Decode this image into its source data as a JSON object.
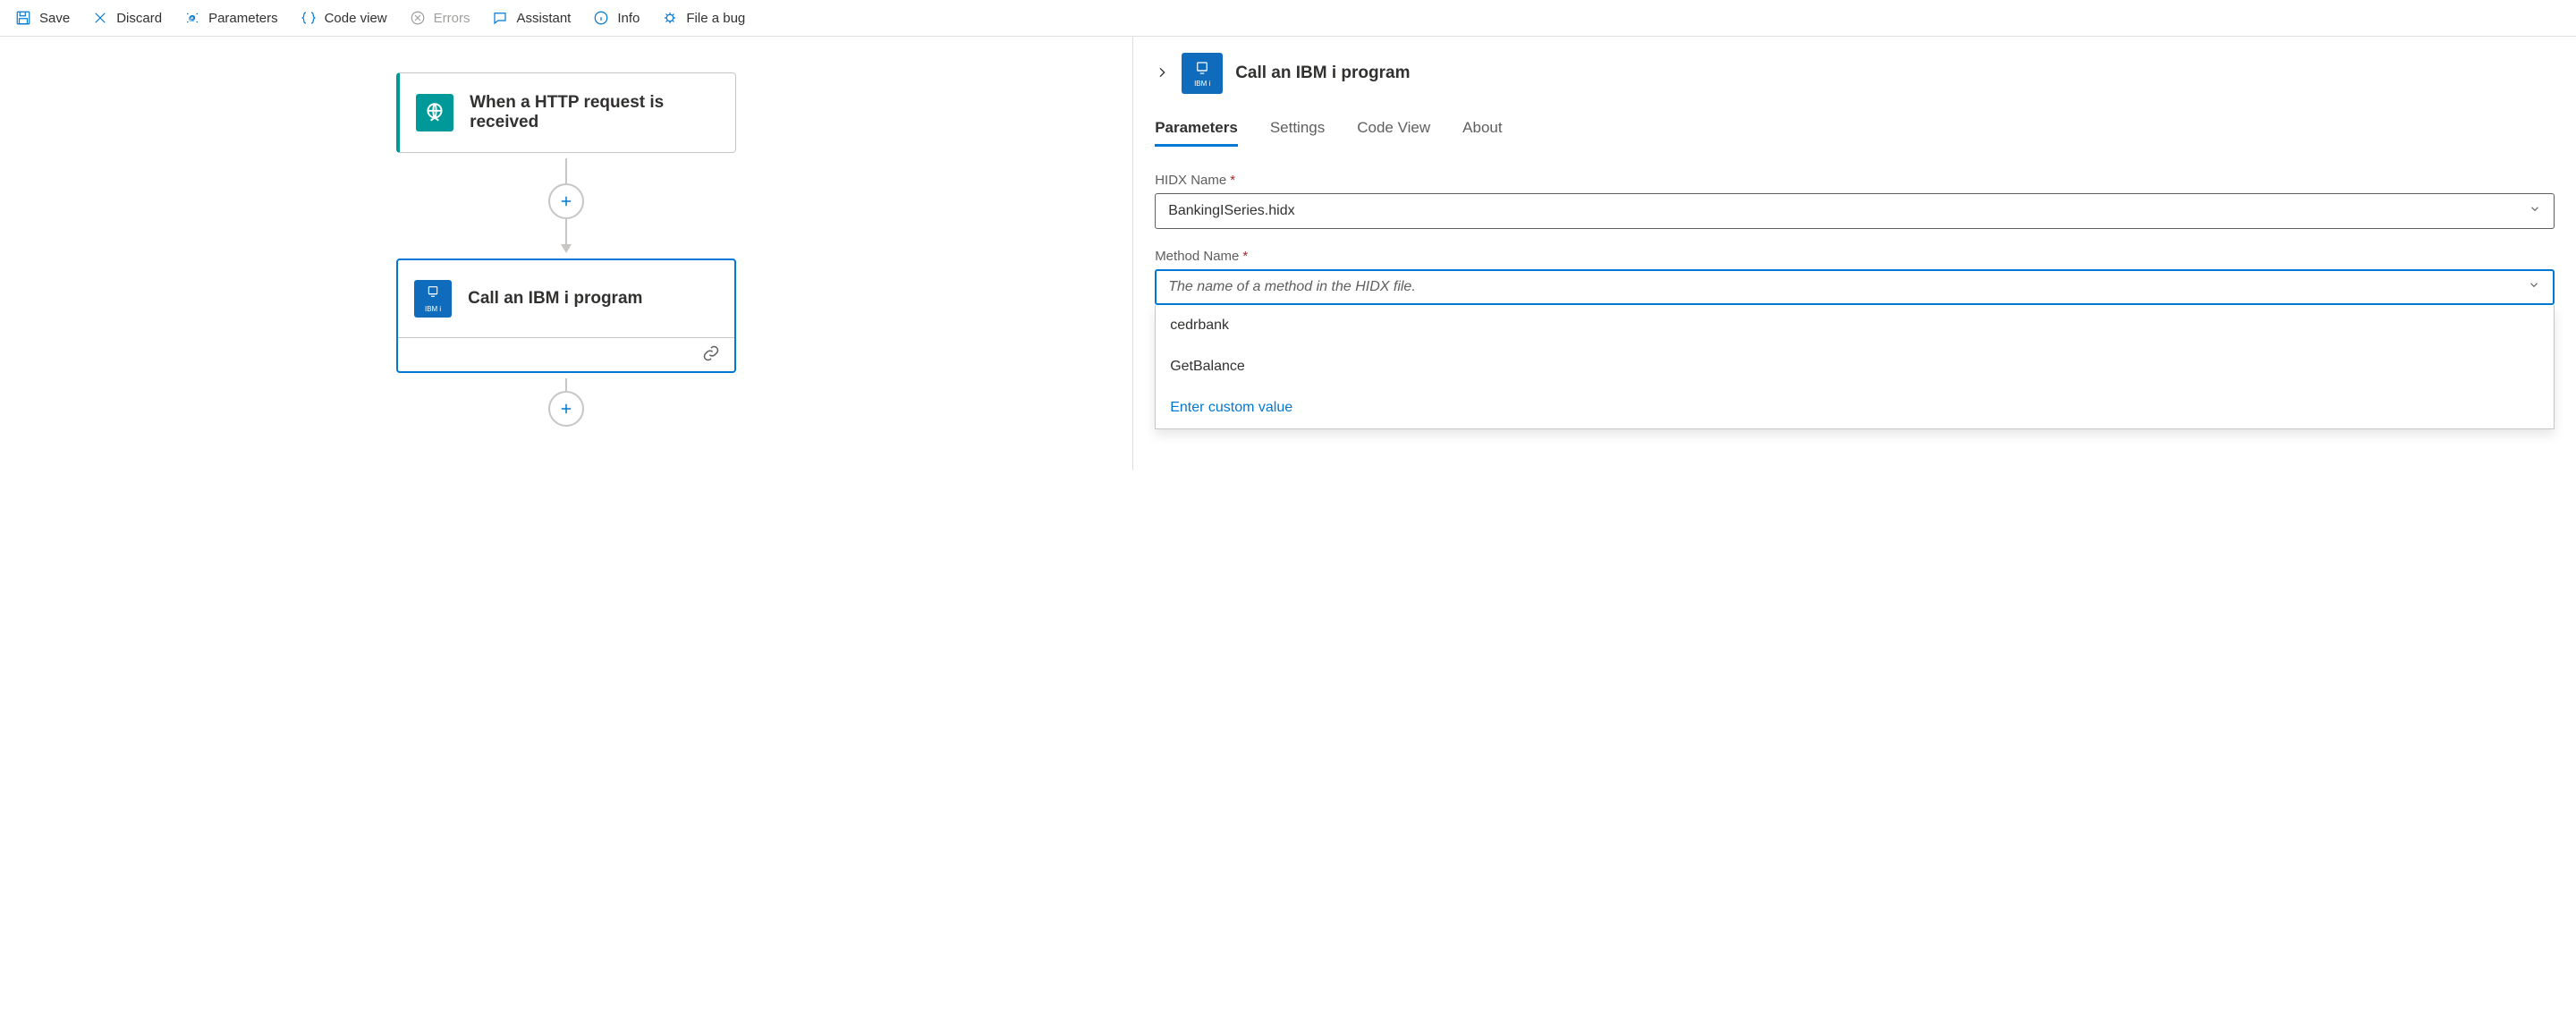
{
  "toolbar": {
    "save": "Save",
    "discard": "Discard",
    "parameters": "Parameters",
    "codeview": "Code view",
    "errors": "Errors",
    "assistant": "Assistant",
    "info": "Info",
    "filebug": "File a bug"
  },
  "canvas": {
    "trigger": {
      "title": "When a HTTP request is received"
    },
    "action": {
      "title": "Call an IBM i program",
      "icon_label": "IBM i"
    }
  },
  "panel": {
    "title": "Call an IBM i program",
    "icon_label": "IBM i",
    "tabs": {
      "parameters": "Parameters",
      "settings": "Settings",
      "codeview": "Code View",
      "about": "About"
    },
    "fields": {
      "hidx": {
        "label": "HIDX Name",
        "value": "BankingISeries.hidx"
      },
      "method": {
        "label": "Method Name",
        "placeholder": "The name of a method in the HIDX file.",
        "options": [
          "cedrbank",
          "GetBalance"
        ],
        "custom": "Enter custom value"
      }
    }
  },
  "colors": {
    "primary": "#0078d4",
    "teal": "#009999",
    "ibm": "#0f6cbd"
  }
}
